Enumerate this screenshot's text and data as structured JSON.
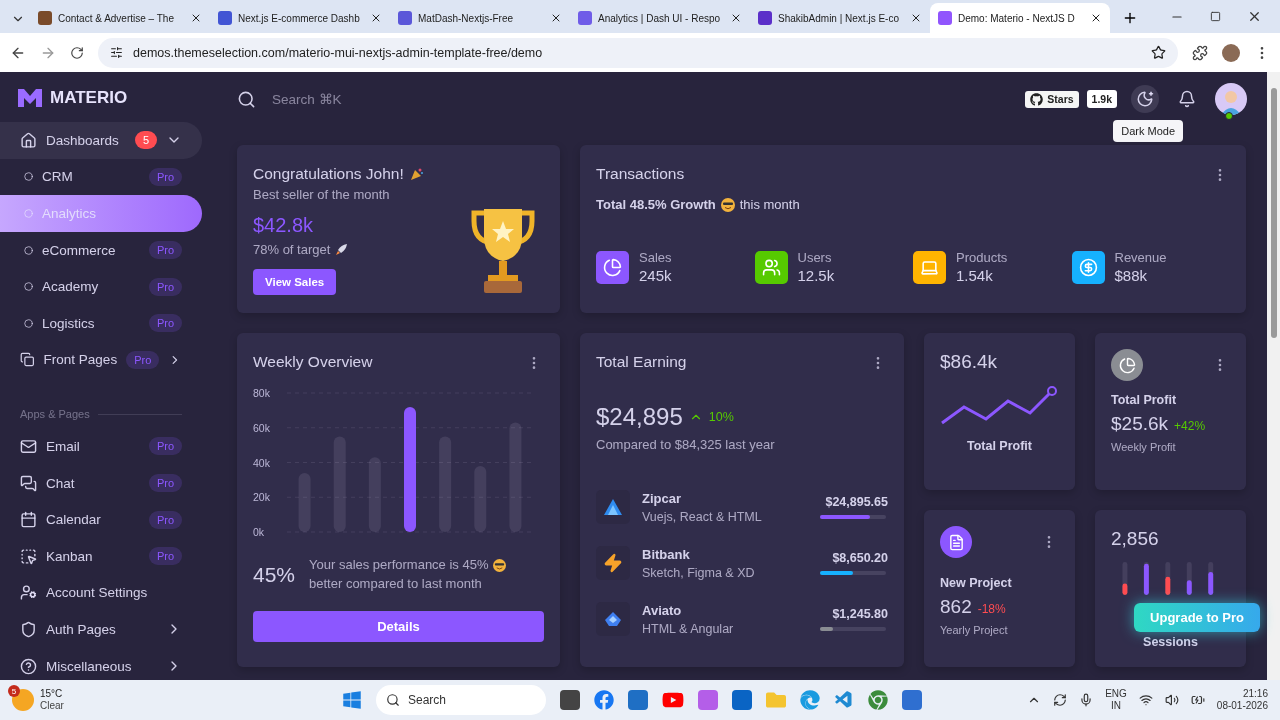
{
  "browser": {
    "tabs": [
      {
        "title": "Contact & Advertise – The",
        "selected": false
      },
      {
        "title": "Next.js E-commerce Dashb",
        "selected": false
      },
      {
        "title": "MatDash-Nextjs-Free",
        "selected": false
      },
      {
        "title": "Analytics | Dash UI - Respo",
        "selected": false
      },
      {
        "title": "ShakibAdmin | Next.js E-co",
        "selected": false
      },
      {
        "title": "Demo: Materio - NextJS D",
        "selected": true
      }
    ],
    "url": "demos.themeselection.com/materio-mui-nextjs-admin-template-free/demo"
  },
  "sidebar": {
    "brand": "MATERIO",
    "items": [
      {
        "label": "Dashboards",
        "badge": "5",
        "expanded": true,
        "children": [
          {
            "label": "CRM",
            "badge": "Pro",
            "selected": false
          },
          {
            "label": "Analytics",
            "selected": true
          },
          {
            "label": "eCommerce",
            "badge": "Pro",
            "selected": false
          },
          {
            "label": "Academy",
            "badge": "Pro",
            "selected": false
          },
          {
            "label": "Logistics",
            "badge": "Pro",
            "selected": false
          }
        ]
      },
      {
        "label": "Front Pages",
        "badge": "Pro",
        "expanded": false
      }
    ],
    "section": "Apps & Pages",
    "section_items": [
      {
        "label": "Email",
        "badge": "Pro"
      },
      {
        "label": "Chat",
        "badge": "Pro"
      },
      {
        "label": "Calendar",
        "badge": "Pro"
      },
      {
        "label": "Kanban",
        "badge": "Pro"
      },
      {
        "label": "Account Settings"
      },
      {
        "label": "Auth Pages",
        "expanded": false
      },
      {
        "label": "Miscellaneous",
        "expanded": false
      }
    ]
  },
  "header": {
    "search": {
      "placeholder": "Search ⌘K"
    },
    "stars_label": "Stars",
    "stars_count": "1.9k",
    "tooltip": "Dark Mode"
  },
  "congrats": {
    "title": "Congratulations John!",
    "subtitle": "Best seller of the month",
    "amount": "$42.8k",
    "target": "78% of target",
    "button": "View Sales"
  },
  "transactions": {
    "title": "Transactions",
    "summary": "**Total 48.5% Growth**",
    "summary_tail": "this month",
    "stats": [
      {
        "label": "Sales",
        "value": "245k",
        "color": "#8c57ff"
      },
      {
        "label": "Users",
        "value": "12.5k",
        "color": "#56ca00"
      },
      {
        "label": "Products",
        "value": "1.54k",
        "color": "#ffb400"
      },
      {
        "label": "Revenue",
        "value": "$88k",
        "color": "#16b1ff"
      }
    ]
  },
  "weekly": {
    "title": "Weekly Overview",
    "percent": "45%",
    "text": "Your sales performance is 45%",
    "text2": "better compared to last month",
    "button": "Details",
    "chart_data": {
      "type": "bar",
      "values": [
        34000,
        55000,
        43000,
        72000,
        55000,
        38000,
        63000
      ],
      "grid": true,
      "ylim": [
        0,
        80000
      ],
      "yticks": [
        {
          "value": 0,
          "label": "0k"
        },
        {
          "value": 20000,
          "label": "20k"
        },
        {
          "value": 40000,
          "label": "40k"
        },
        {
          "value": 60000,
          "label": "60k"
        },
        {
          "value": 80000,
          "label": "80k"
        }
      ]
    }
  },
  "earning": {
    "title": "Total Earning",
    "amount": "$24,895",
    "change": "10%",
    "compare": "Compared to $84,325 last year",
    "items": [
      {
        "name": "Zipcar",
        "tech": "Vuejs, React & HTML",
        "amount": "$24,895.65",
        "level": 0.75,
        "color": "#8c57ff"
      },
      {
        "name": "Bitbank",
        "tech": "Sketch, Figma & XD",
        "amount": "$8,650.20",
        "level": 0.5,
        "color": "#16b1ff"
      },
      {
        "name": "Aviato",
        "tech": "HTML & Angular",
        "amount": "$1,245.80",
        "level": 0.2,
        "color": "#8a8d93"
      }
    ]
  },
  "profit_chart": {
    "amount": "$86.4k",
    "label": "Total Profit"
  },
  "profit": {
    "title": "Total Profit",
    "amount": "$25.6k",
    "change": "+42%",
    "positive": true,
    "caption": "Weekly Profit"
  },
  "project": {
    "title": "New Project",
    "amount": "862",
    "change": "-18%",
    "positive": false,
    "caption": "Yearly Project"
  },
  "sessions": {
    "amount": "2,856",
    "caption": "Sessions"
  },
  "upgrade": "Upgrade to Pro",
  "taskbar": {
    "weather_badge": "5",
    "temperature": "15°C",
    "condition": "Clear",
    "search": "Search",
    "language": "ENG",
    "region": "IN",
    "time": "21:16",
    "date": "08-01-2026"
  }
}
